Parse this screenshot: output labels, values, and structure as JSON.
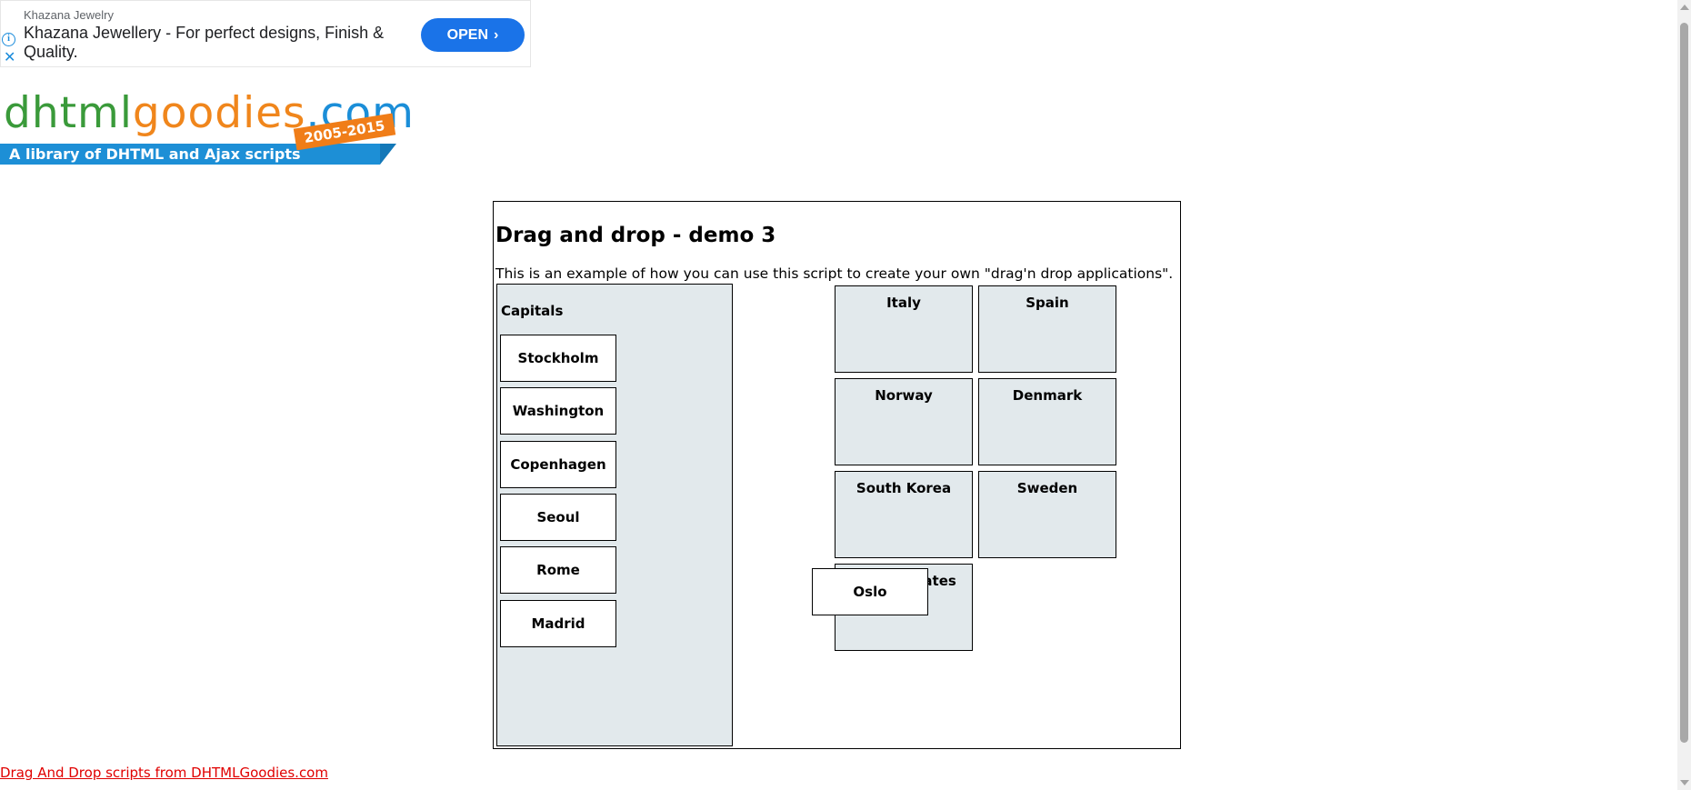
{
  "ad": {
    "advertiser": "Khazana Jewelry",
    "headline": "Khazana Jewellery - For perfect designs, Finish & Quality.",
    "open_label": "OPEN",
    "open_chevron": "›",
    "info_glyph": "i",
    "close_glyph": "✕"
  },
  "logo": {
    "part1": "dhtml",
    "part2": "goodies",
    "part3": ".com",
    "years": "2005-2015",
    "tagline": "A library of DHTML and Ajax scripts"
  },
  "demo": {
    "title": "Drag and drop - demo 3",
    "intro": "This is an example of how you can use this script to create your own \"drag'n drop applications\".",
    "capitals_title": "Capitals",
    "capitals": [
      "Stockholm",
      "Washington",
      "Copenhagen",
      "Seoul",
      "Rome",
      "Madrid"
    ],
    "countries": [
      "Italy",
      "Spain",
      "Norway",
      "Denmark",
      "South Korea",
      "Sweden",
      "United States"
    ],
    "dragging_item": "Oslo"
  },
  "footer": {
    "link_text": "Drag And Drop scripts from DHTMLGoodies.com"
  }
}
